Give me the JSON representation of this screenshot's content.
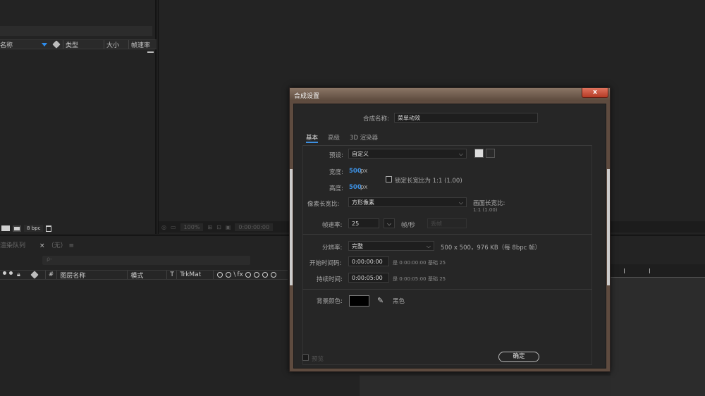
{
  "project": {
    "columns": {
      "name": "名称",
      "type": "类型",
      "size": "大小",
      "framerate": "帧速率"
    },
    "footer": {
      "bpc": "8 bpc"
    }
  },
  "viewer": {
    "zoom": "100%",
    "timecode": "0:00:00:00"
  },
  "timeline": {
    "tabs": {
      "render_queue": "渲染队列",
      "comp_tab": "（无）"
    },
    "search_placeholder": "ρ-",
    "columns": {
      "index": "#",
      "layer_name": "图层名称",
      "mode": "模式",
      "t": "T",
      "trkmat": "TrkMat"
    }
  },
  "dialog": {
    "title": "合成设置",
    "close": "x",
    "comp_name_label": "合成名称:",
    "comp_name_value": "菜单动效",
    "tabs": [
      "基本",
      "高级",
      "3D 渲染器"
    ],
    "preset_label": "预设:",
    "preset_value": "自定义",
    "width_label": "宽度:",
    "width_value": "500",
    "width_unit": "px",
    "height_label": "高度:",
    "height_value": "500",
    "height_unit": "px",
    "lock_ratio_label": "锁定长宽比为 1:1 (1.00)",
    "pixel_aspect_label": "像素长宽比:",
    "pixel_aspect_value": "方形像素",
    "frame_aspect_label": "画面长宽比:",
    "frame_aspect_value": "1:1 (1.00)",
    "framerate_label": "帧速率:",
    "framerate_value": "25",
    "framerate_unit": "帧/秒",
    "drop_frame": "丢帧",
    "resolution_label": "分辨率:",
    "resolution_value": "完整",
    "resolution_info": "500 x 500，976 KB（每 8bpc 帧）",
    "start_tc_label": "开始时间码:",
    "start_tc_value": "0:00:00:00",
    "start_tc_info": "是 0:00:00:00",
    "start_tc_base": "基础 25",
    "duration_label": "持续时间:",
    "duration_value": "0:00:05:00",
    "duration_info": "是 0:00:05:00",
    "duration_base": "基础 25",
    "bgcolor_label": "背景颜色:",
    "bgcolor_name": "黑色",
    "bgcolor": "#000000",
    "preview_label": "预览",
    "ok_label": "确定"
  }
}
